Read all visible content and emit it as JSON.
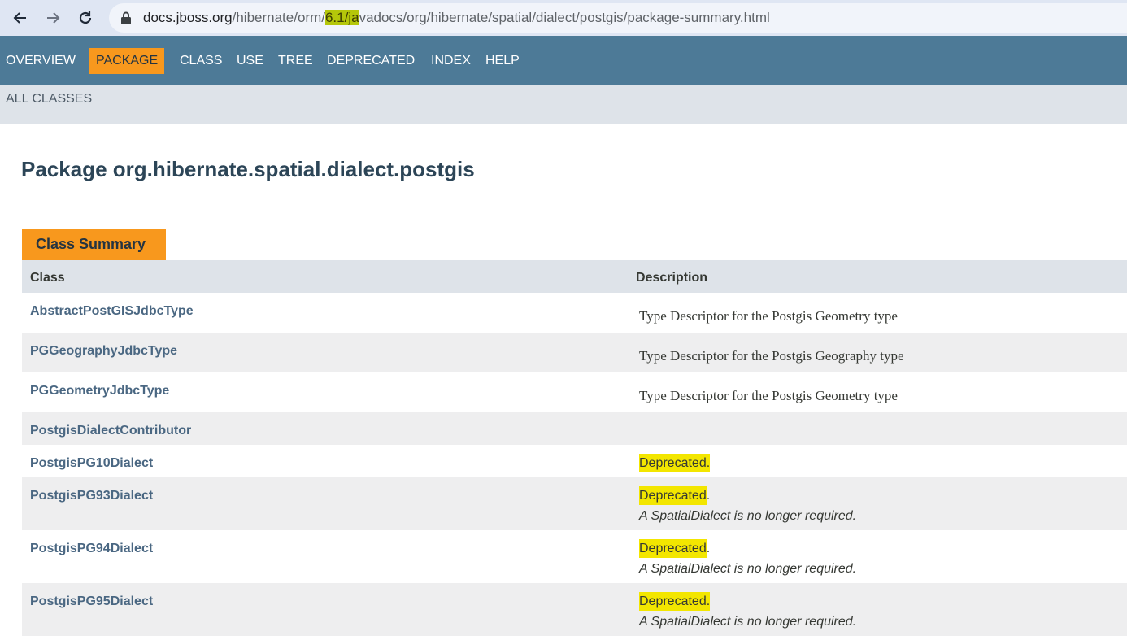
{
  "browser": {
    "url_host": "docs.jboss.org",
    "url_path_a": "/hibernate/orm/",
    "url_path_version": "6.1/ja",
    "url_path_b": "vadocs/org/hibernate/spatial/dialect/postgis/package-summary.html",
    "icons": [
      "back-arrow-icon",
      "forward-arrow-icon",
      "reload-icon",
      "lock-icon"
    ]
  },
  "navbar": {
    "items": [
      "OVERVIEW",
      "PACKAGE",
      "CLASS",
      "USE",
      "TREE",
      "DEPRECATED",
      "INDEX",
      "HELP"
    ],
    "active": "PACKAGE",
    "active_color": "#f8981d",
    "bar_color": "#4d7a97"
  },
  "subnav": {
    "all_classes": "ALL CLASSES"
  },
  "page": {
    "title": "Package org.hibernate.spatial.dialect.postgis"
  },
  "summary": {
    "caption": "Class Summary",
    "col_class": "Class",
    "col_description": "Description",
    "rows": [
      {
        "name": "AbstractPostGISJdbcType",
        "description": "Type Descriptor for the Postgis Geometry type"
      },
      {
        "name": "PGGeographyJdbcType",
        "description": "Type Descriptor for the Postgis Geography type"
      },
      {
        "name": "PGGeometryJdbcType",
        "description": "Type Descriptor for the Postgis Geometry type"
      },
      {
        "name": "PostgisDialectContributor",
        "description": ""
      },
      {
        "name": "PostgisPG10Dialect",
        "deprecated_label": "Deprecated",
        "deprecated_tail": "."
      },
      {
        "name": "PostgisPG93Dialect",
        "deprecated_label": "Deprecated",
        "deprecated_tail": ".",
        "note": "A SpatialDialect is no longer required."
      },
      {
        "name": "PostgisPG94Dialect",
        "deprecated_label": "Deprecated",
        "deprecated_tail": ".",
        "note": "A SpatialDialect is no longer required."
      },
      {
        "name": "PostgisPG95Dialect",
        "deprecated_label": "Deprecated",
        "deprecated_tail": ".",
        "note": "A SpatialDialect is no longer required."
      }
    ]
  },
  "colors": {
    "highlight": "#f3e600",
    "link": "#4a6782",
    "title": "#2c4557"
  }
}
